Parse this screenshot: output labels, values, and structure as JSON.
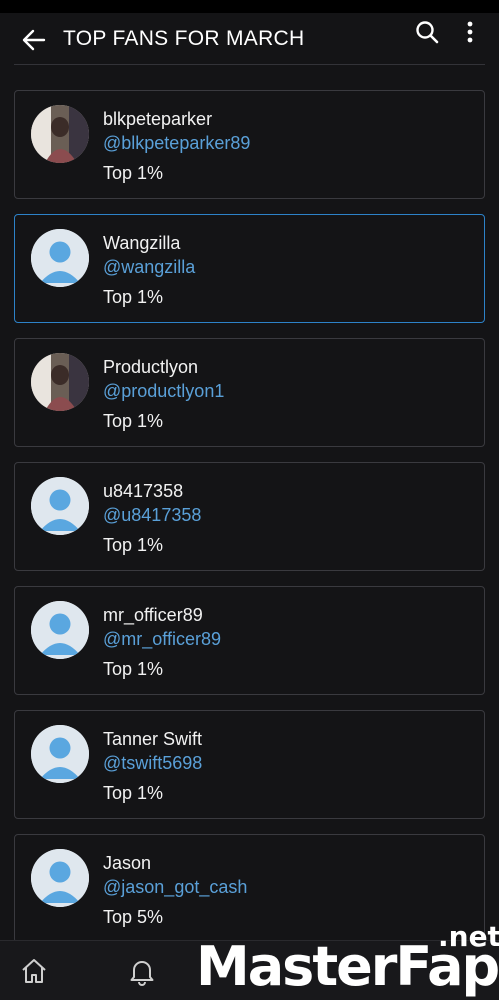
{
  "header": {
    "title": "TOP FANS FOR MARCH",
    "back_icon": "arrow-left-icon",
    "search_icon": "search-icon",
    "more_icon": "more-vertical-icon"
  },
  "fans": [
    {
      "name": "blkpeteparker",
      "handle": "@blkpeteparker89",
      "rank": "Top 1%",
      "avatar": "photo",
      "selected": false
    },
    {
      "name": "Wangzilla",
      "handle": "@wangzilla",
      "rank": "Top 1%",
      "avatar": "default",
      "selected": true
    },
    {
      "name": "Productlyon",
      "handle": "@productlyon1",
      "rank": "Top 1%",
      "avatar": "photo",
      "selected": false
    },
    {
      "name": "u8417358",
      "handle": "@u8417358",
      "rank": "Top 1%",
      "avatar": "default",
      "selected": false
    },
    {
      "name": "mr_officer89",
      "handle": "@mr_officer89",
      "rank": "Top 1%",
      "avatar": "default",
      "selected": false
    },
    {
      "name": "Tanner Swift",
      "handle": "@tswift5698",
      "rank": "Top 1%",
      "avatar": "default",
      "selected": false
    },
    {
      "name": "Jason",
      "handle": "@jason_got_cash",
      "rank": "Top 5%",
      "avatar": "default",
      "selected": false
    }
  ],
  "bottom_nav": [
    {
      "icon": "home-icon"
    },
    {
      "icon": "bell-icon"
    }
  ],
  "watermark": {
    "main": "MasterFap",
    "suffix": ".net"
  },
  "colors": {
    "background": "#141416",
    "card_border": "#3a3a3f",
    "selected_border": "#2d82c8",
    "handle": "#5aa0d8",
    "default_avatar_bg": "#dfe7ee",
    "default_avatar_fg": "#5aa7e0"
  }
}
